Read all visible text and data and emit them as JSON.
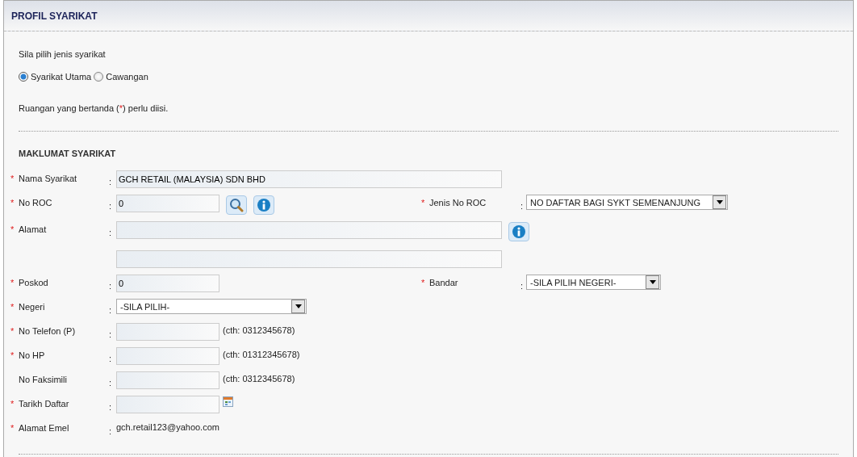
{
  "title": "PROFIL SYARIKAT",
  "company_type": {
    "prompt": "Sila pilih jenis syarikat",
    "options": [
      {
        "label": "Syarikat Utama",
        "selected": true
      },
      {
        "label": "Cawangan",
        "selected": false
      }
    ]
  },
  "note": {
    "before": "Ruangan yang bertanda (",
    "mark": "*",
    "after": ") perlu diisi."
  },
  "section_title": "MAKLUMAT SYARIKAT",
  "rows": [
    {
      "marker": "*",
      "label": "Nama Syarikat",
      "separator": ":",
      "field": {
        "kind": "wide-text",
        "value": "GCH RETAIL (MALAYSIA) SDN BHD"
      }
    },
    {
      "marker": "*",
      "label": "No ROC",
      "separator": ":",
      "field": {
        "kind": "text",
        "value": "0",
        "buttons": [
          {
            "kind": "search"
          },
          {
            "kind": "info"
          }
        ]
      },
      "right": {
        "marker": "*",
        "label": "Jenis No ROC",
        "separator": ":",
        "field": {
          "kind": "wide-select",
          "value": "NO DAFTAR BAGI SYKT SEMENANJUNG"
        }
      }
    },
    {
      "marker": "*",
      "label": "Alamat",
      "separator": ":",
      "field": {
        "kind": "address",
        "buttons": [
          {
            "kind": "info"
          }
        ]
      }
    },
    {
      "marker": "*",
      "label": "Poskod",
      "separator": ":",
      "field": {
        "kind": "text",
        "value": "0"
      },
      "right": {
        "marker": "*",
        "label": "Bandar",
        "separator": ":",
        "field": {
          "kind": "select",
          "value": "-SILA PILIH NEGERI-"
        }
      }
    },
    {
      "marker": "*",
      "label": "Negeri",
      "separator": ":",
      "field": {
        "kind": "select",
        "value": "-SILA PILIH-"
      }
    },
    {
      "marker": "*",
      "label": "No Telefon (P)",
      "separator": ":",
      "field": {
        "kind": "text",
        "hint": "(cth: 0312345678)"
      }
    },
    {
      "marker": "*",
      "label": "No HP",
      "separator": ":",
      "field": {
        "kind": "text",
        "hint": "(cth: 01312345678)"
      }
    },
    {
      "label": "No Faksimili",
      "separator": ":",
      "field": {
        "kind": "text",
        "hint": "(cth: 0312345678)"
      }
    },
    {
      "marker": "*",
      "label": "Tarikh Daftar",
      "separator": ":",
      "field": {
        "kind": "date"
      }
    },
    {
      "marker": "*",
      "label": "Alamat Emel",
      "separator": ":",
      "field": {
        "kind": "static",
        "value": "gch.retail123@yahoo.com"
      }
    }
  ]
}
